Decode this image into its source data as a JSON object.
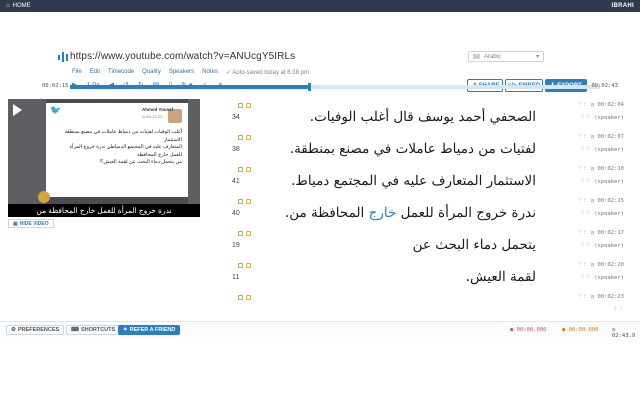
{
  "topbar": {
    "home": "HOME",
    "user": "IBRAHI"
  },
  "header": {
    "url": "https://www.youtube.com/watch?v=ANUcgY5IRLs",
    "menu": [
      "File",
      "Edit",
      "Timecode",
      "Quality",
      "Speakers",
      "Notes"
    ],
    "autosave": "Auto-saved today at 6:38 pm",
    "speed": "1.0x",
    "language": "Arabic",
    "share_label": "SHARE",
    "embed_label": "EMBED",
    "export_label": "EXPORT"
  },
  "timeline": {
    "start": "00:02:15",
    "end": "00:02:43",
    "progress": 0.45
  },
  "video": {
    "card_name": "Ahmed Yousef",
    "card_date": "2015-12-29",
    "card_lines": [
      "أغلب الوفيات لفتيات من دمياط عاملات في مصنع بمنطقة الاستثمار",
      "المتعارف عليه في المجتمع الدمياطي ندرة خروج المرأة",
      "للعمل خارج المحافظة",
      "من يتحمل دماء البحث عن لقمة العيش؟!"
    ],
    "caption": "ندرة خروج المرأة للعمل خارج المحافظة من",
    "hide_label": "HIDE VIDEO"
  },
  "segments": [
    {
      "num": "34",
      "text": "الصحفي أحمد يوسف قال أغلب الوفيات.",
      "hl": "",
      "time": "00:02:04",
      "speaker": "(speaker)"
    },
    {
      "num": "38",
      "text": "لفتيات من دمياط عاملات في مصنع بمنطقة.",
      "hl": "",
      "time": "00:02:07",
      "speaker": "(speaker)"
    },
    {
      "num": "41",
      "text": "الاستثمار المتعارف عليه في المجتمع دمياط.",
      "hl": "",
      "time": "00:02:10",
      "speaker": "(speaker)"
    },
    {
      "num": "40",
      "text": "ندرة خروج المرأة للعمل ",
      "hl": "خارج",
      "after": " المحافظة من.",
      "time": "00:02:15",
      "speaker": "(speaker)"
    },
    {
      "num": "19",
      "text": "يتحمل دماء البحث عن",
      "hl": "",
      "time": "00:02:17",
      "speaker": "(speaker)"
    },
    {
      "num": "11",
      "text": "لقمة العيش.",
      "hl": "",
      "time": "00:02:20",
      "speaker": "(speaker)"
    },
    {
      "num": "",
      "text": "",
      "hl": "",
      "time": "00:02:23",
      "speaker": ""
    }
  ],
  "bottombar": {
    "preferences": "PREFERENCES",
    "shortcuts": "SHORTCUTS",
    "refer": "REFER A FRIEND",
    "t1": "00:00.000",
    "t2": "00:00.000",
    "t3": "02:43.9"
  },
  "colors": {
    "accent": "#2a7fc1",
    "topbar": "#2f3b4c",
    "warn": "#d9534f"
  }
}
